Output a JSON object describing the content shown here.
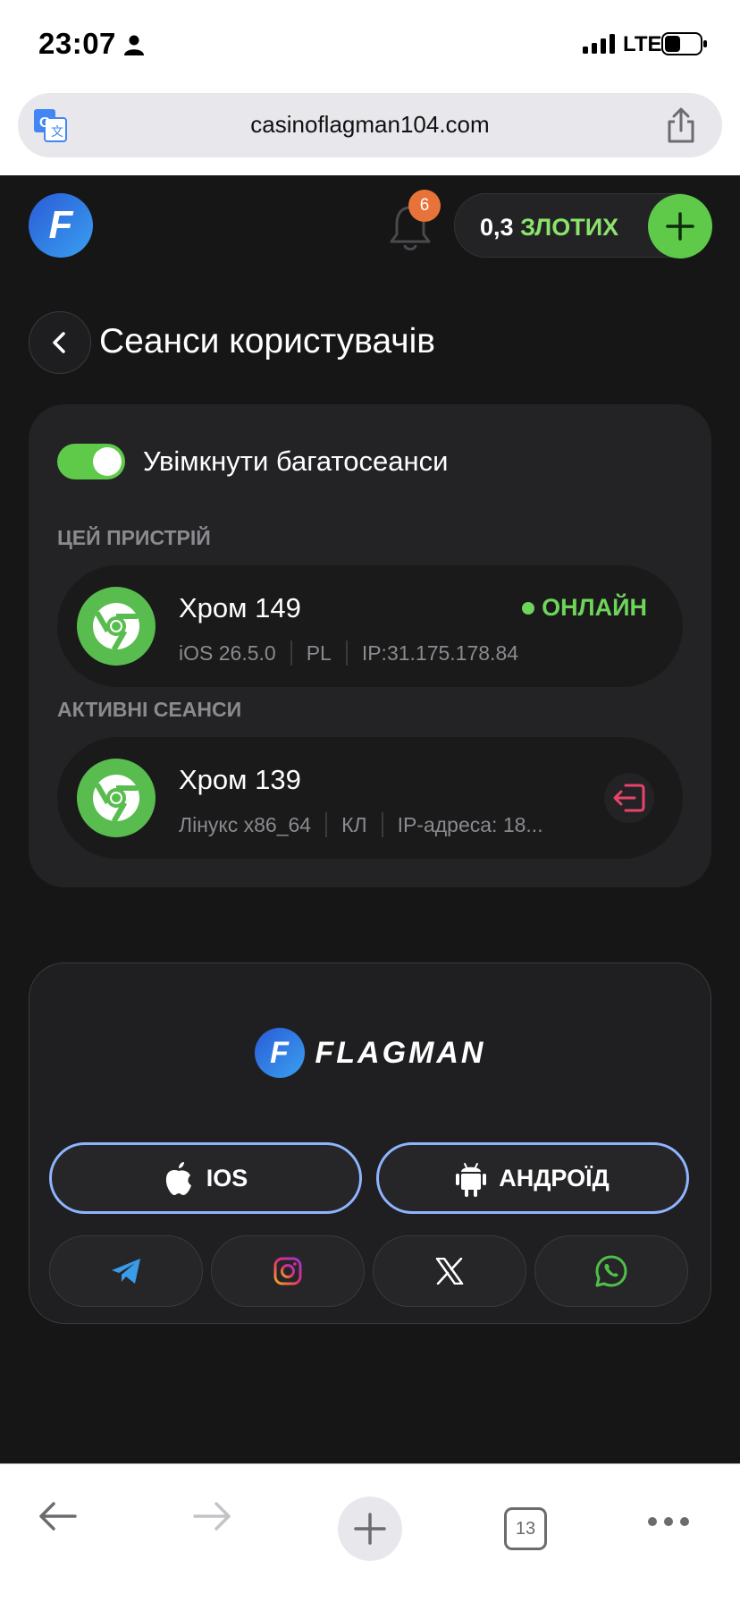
{
  "status_bar": {
    "time": "23:07",
    "network": "LTE"
  },
  "browser": {
    "url": "casinoflagman104.com",
    "tabs_count": "13"
  },
  "header": {
    "logo_letter": "F",
    "notifications_count": "6",
    "balance_amount": "0,3",
    "balance_currency": "ЗЛОТИХ"
  },
  "page": {
    "title": "Сеанси користувачів"
  },
  "multisession": {
    "label": "Увімкнути багатосеанси",
    "enabled": true
  },
  "this_device": {
    "section_label": "ЦЕЙ ПРИСТРІЙ",
    "name": "Хром 149",
    "os": "iOS 26.5.0",
    "country": "PL",
    "ip": "IP:31.175.178.84",
    "status": "ОНЛАЙН"
  },
  "active_sessions": {
    "section_label": "АКТИВНІ СЕАНСИ",
    "items": [
      {
        "name": "Хром 139",
        "os": "Лінукс x86_64",
        "country": "КЛ",
        "ip": "IP-адреса: 18..."
      }
    ]
  },
  "footer": {
    "brand_letter": "F",
    "brand_name": "FLAGMAN",
    "ios_label": "IOS",
    "android_label": "АНДРОЇД"
  },
  "colors": {
    "accent_green": "#5fc94a",
    "online_green": "#6fd45a",
    "logout_pink": "#e8436b",
    "badge_orange": "#e8733a"
  }
}
